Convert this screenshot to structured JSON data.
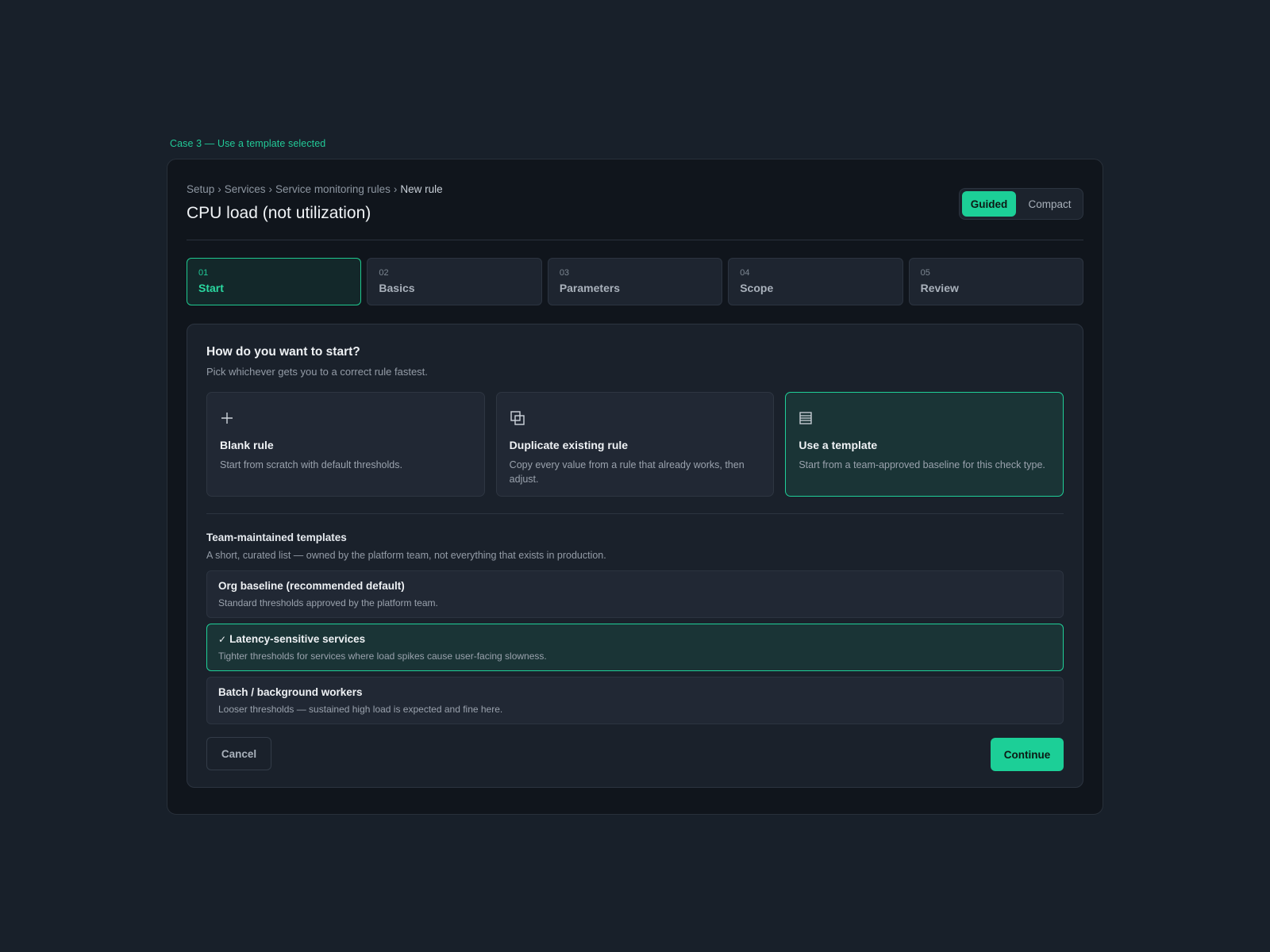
{
  "case_label": "Case 3 — Use a template selected",
  "breadcrumb": {
    "items": [
      "Setup",
      "Services",
      "Service monitoring rules"
    ],
    "current": "New rule",
    "separator": "›"
  },
  "page_title": "CPU load (not utilization)",
  "mode_toggle": {
    "guided": "Guided",
    "compact": "Compact",
    "selected": "Guided"
  },
  "steps": [
    {
      "num": "01",
      "label": "Start",
      "active": true
    },
    {
      "num": "02",
      "label": "Basics",
      "active": false
    },
    {
      "num": "03",
      "label": "Parameters",
      "active": false
    },
    {
      "num": "04",
      "label": "Scope",
      "active": false
    },
    {
      "num": "05",
      "label": "Review",
      "active": false
    }
  ],
  "start": {
    "title": "How do you want to start?",
    "subtitle": "Pick whichever gets you to a correct rule fastest.",
    "options": [
      {
        "icon": "plus-icon",
        "title": "Blank rule",
        "desc": "Start from scratch with default thresholds.",
        "selected": false
      },
      {
        "icon": "duplicate-icon",
        "title": "Duplicate existing rule",
        "desc": "Copy every value from a rule that already works, then adjust.",
        "selected": false
      },
      {
        "icon": "template-icon",
        "title": "Use a template",
        "desc": "Start from a team-approved baseline for this check type.",
        "selected": true
      }
    ]
  },
  "templates": {
    "title": "Team-maintained templates",
    "subtitle": "A short, curated list — owned by the platform team, not everything that exists in production.",
    "items": [
      {
        "name": "Org baseline (recommended default)",
        "desc": "Standard thresholds approved by the platform team.",
        "selected": false
      },
      {
        "name": "Latency-sensitive services",
        "desc": "Tighter thresholds for services where load spikes cause user-facing slowness.",
        "selected": true
      },
      {
        "name": "Batch / background workers",
        "desc": "Looser thresholds — sustained high load is expected and fine here.",
        "selected": false
      }
    ]
  },
  "actions": {
    "cancel": "Cancel",
    "continue": "Continue"
  },
  "colors": {
    "accent": "#1ccf97",
    "background": "#18202a",
    "frame": "#10151c",
    "selected_bg": "#1a3436"
  }
}
